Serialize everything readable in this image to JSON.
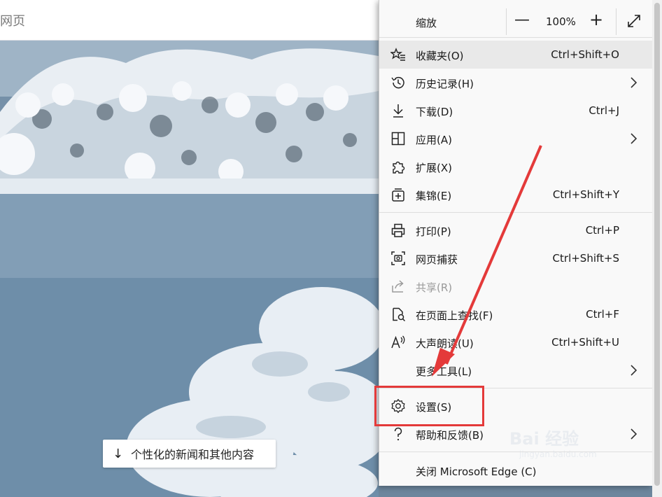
{
  "search": {
    "placeholder": "网页"
  },
  "news_button": {
    "arrow": "↓",
    "label": "个性化的新闻和其他内容"
  },
  "zoom": {
    "label": "缩放",
    "minus": "—",
    "value": "100%",
    "plus": "+"
  },
  "menu": {
    "items": [
      {
        "label": "收藏夹(O)",
        "shortcut": "Ctrl+Shift+O",
        "icon": "favorites-icon"
      },
      {
        "label": "历史记录(H)",
        "shortcut": "",
        "icon": "history-icon",
        "submenu": true
      },
      {
        "label": "下载(D)",
        "shortcut": "Ctrl+J",
        "icon": "download-icon"
      },
      {
        "label": "应用(A)",
        "shortcut": "",
        "icon": "apps-icon",
        "submenu": true
      },
      {
        "label": "扩展(X)",
        "shortcut": "",
        "icon": "extensions-icon"
      },
      {
        "label": "集锦(E)",
        "shortcut": "Ctrl+Shift+Y",
        "icon": "collections-icon"
      },
      {
        "label": "打印(P)",
        "shortcut": "Ctrl+P",
        "icon": "print-icon"
      },
      {
        "label": "网页捕获",
        "shortcut": "Ctrl+Shift+S",
        "icon": "web-capture-icon"
      },
      {
        "label": "共享(R)",
        "shortcut": "",
        "icon": "share-icon",
        "disabled": true
      },
      {
        "label": "在页面上查找(F)",
        "shortcut": "Ctrl+F",
        "icon": "find-on-page-icon"
      },
      {
        "label": "大声朗读(U)",
        "shortcut": "Ctrl+Shift+U",
        "icon": "read-aloud-icon"
      },
      {
        "label": "更多工具(L)",
        "shortcut": "",
        "icon": "",
        "submenu": true
      },
      {
        "label": "设置(S)",
        "shortcut": "",
        "icon": "settings-icon"
      },
      {
        "label": "帮助和反馈(B)",
        "shortcut": "",
        "icon": "help-icon",
        "submenu": true
      },
      {
        "label": "关闭 Microsoft Edge (C)",
        "shortcut": "",
        "icon": ""
      }
    ]
  },
  "annotation": {
    "color": "#e43a3a",
    "target": "设置(S)"
  },
  "watermark": {
    "text": "Bai 经验",
    "sub": "jingyan.baidu.com"
  }
}
